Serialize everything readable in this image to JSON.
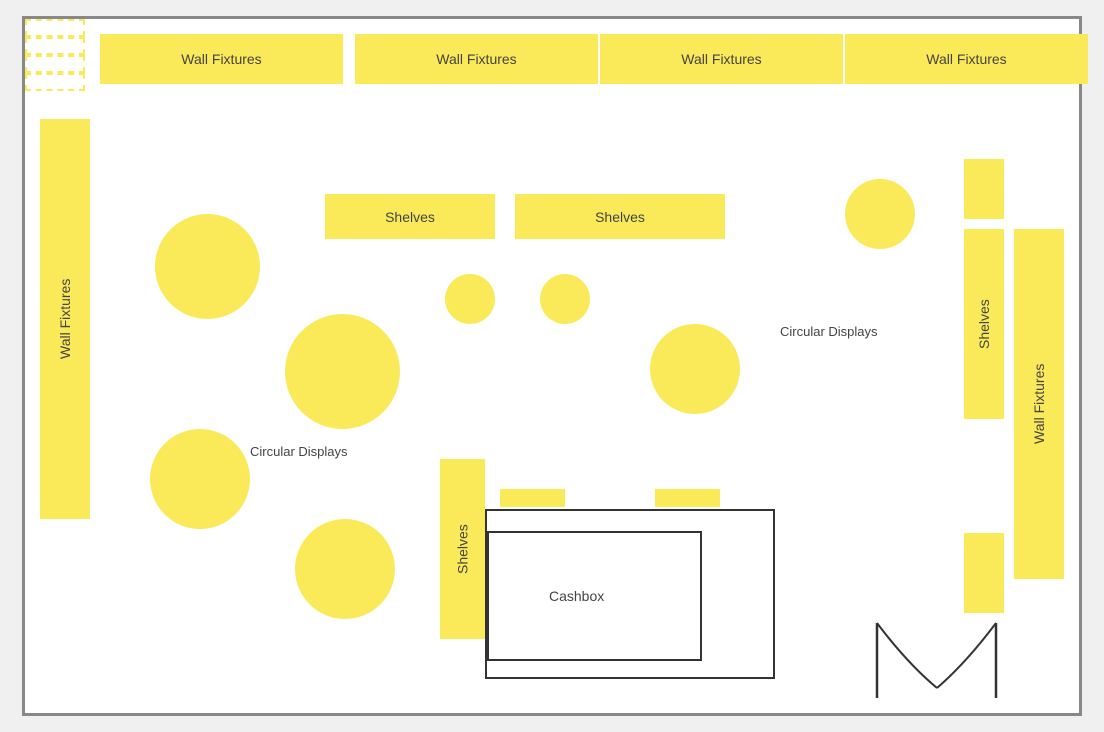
{
  "labels": {
    "wall_fixtures": "Wall Fixtures",
    "shelves": "Shelves",
    "circular_displays": "Circular Displays",
    "cashbox": "Cashbox"
  },
  "colors": {
    "yellow": "#FAEA5A",
    "border": "#888",
    "text": "#444"
  }
}
